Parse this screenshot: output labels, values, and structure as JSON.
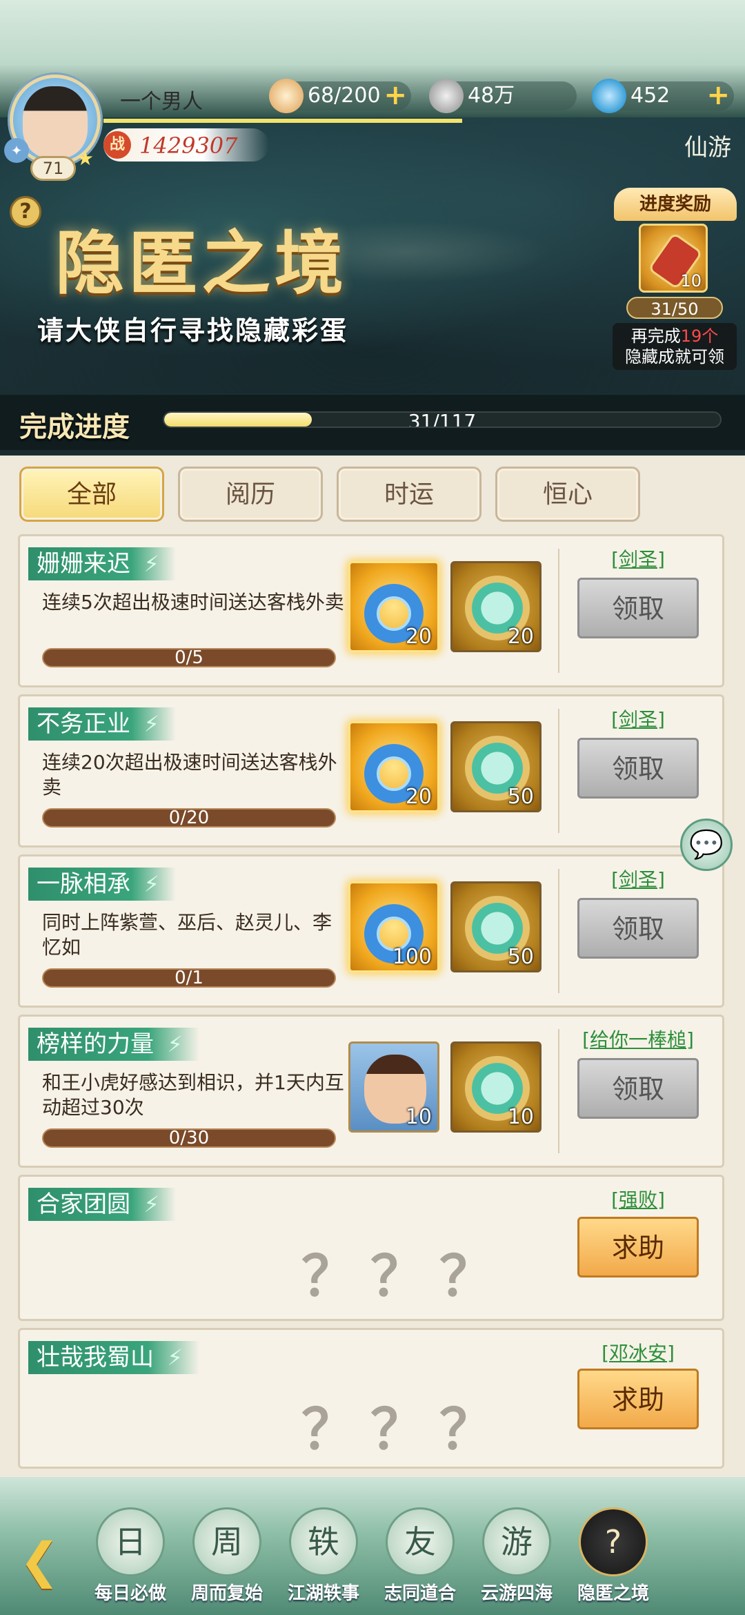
{
  "header": {
    "player_name": "一个男人",
    "level": "71",
    "power_badge": "战",
    "power": "1429307",
    "server_label": "仙游",
    "resources": [
      {
        "name": "bun-stamina",
        "value": "68/200"
      },
      {
        "name": "coins",
        "value": "48万"
      },
      {
        "name": "jade",
        "value": "452"
      }
    ]
  },
  "banner": {
    "title": "隐匿之境",
    "subtitle": "请大侠自行寻找隐藏彩蛋",
    "reward_title": "进度奖励",
    "reward_count": "10",
    "reward_progress": "31/50",
    "reward_note_prefix": "再完成",
    "reward_note_highlight": "19个",
    "reward_note_suffix": "隐藏成就可领",
    "progress_label": "完成进度",
    "progress_text": "31/117",
    "progress_value": 31,
    "progress_max": 117
  },
  "tabs": [
    "全部",
    "阅历",
    "时运",
    "恒心"
  ],
  "tasks": [
    {
      "title": "姗姗来迟",
      "desc": "连续5次超出极速时间送达客栈外卖",
      "progress": "0/5",
      "rewards": [
        "20",
        "20"
      ],
      "tag": "[剑圣]",
      "button": "领取"
    },
    {
      "title": "不务正业",
      "desc": "连续20次超出极速时间送达客栈外卖",
      "progress": "0/20",
      "rewards": [
        "20",
        "50"
      ],
      "tag": "[剑圣]",
      "button": "领取"
    },
    {
      "title": "一脉相承",
      "desc": "同时上阵紫萱、巫后、赵灵儿、李忆如",
      "progress": "0/1",
      "rewards": [
        "100",
        "50"
      ],
      "tag": "[剑圣]",
      "button": "领取"
    },
    {
      "title": "榜样的力量",
      "desc": "和王小虎好感达到相识，并1天内互动超过30次",
      "progress": "0/30",
      "rewards": [
        "10",
        "10"
      ],
      "tag": "[给你一棒槌]",
      "button": "领取"
    },
    {
      "title": "合家团圆",
      "hidden": "？？？",
      "tag": "[强败]",
      "button": "求助"
    },
    {
      "title": "壮哉我蜀山",
      "hidden": "？？？",
      "tag": "[邓冰安]",
      "button": "求助"
    }
  ],
  "nav": [
    "每日必做",
    "周而复始",
    "江湖轶事",
    "志同道合",
    "云游四海",
    "隐匿之境"
  ],
  "nav_icons": [
    "日",
    "周",
    "轶",
    "友",
    "游",
    "?"
  ]
}
